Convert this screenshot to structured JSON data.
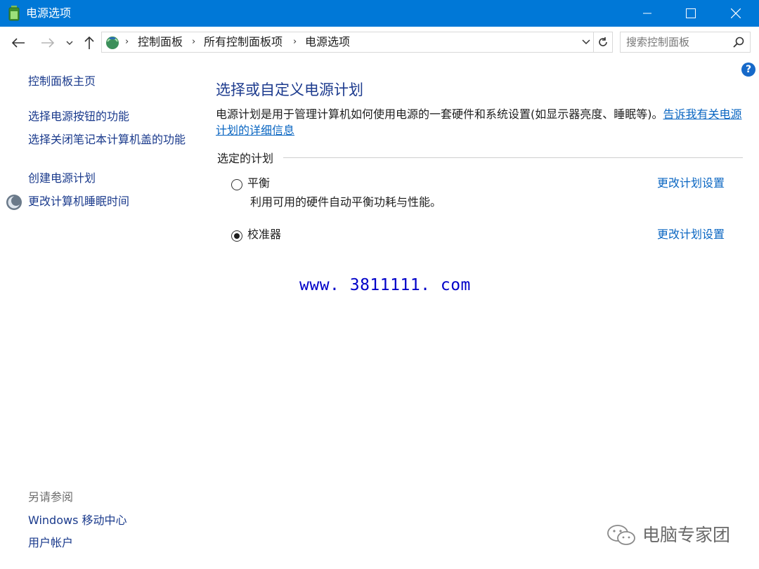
{
  "window": {
    "title": "电源选项"
  },
  "toolbar": {
    "breadcrumbs": [
      "控制面板",
      "所有控制面板项",
      "电源选项"
    ],
    "search_placeholder": "搜索控制面板"
  },
  "sidebar": {
    "home": "控制面板主页",
    "links": [
      "选择电源按钮的功能",
      "选择关闭笔记本计算机盖的功能",
      "创建电源计划",
      "更改计算机睡眠时间"
    ],
    "see_also_label": "另请参阅",
    "see_also": [
      "Windows 移动中心",
      "用户帐户"
    ]
  },
  "main": {
    "heading": "选择或自定义电源计划",
    "description": "电源计划是用于管理计算机如何使用电源的一套硬件和系统设置(如显示器亮度、睡眠等)。",
    "description_link": "告诉我有关电源计划的详细信息",
    "section_label": "选定的计划",
    "plans": [
      {
        "name": "平衡",
        "description": "利用可用的硬件自动平衡功耗与性能。",
        "selected": false,
        "action": "更改计划设置"
      },
      {
        "name": "校准器",
        "description": "",
        "selected": true,
        "action": "更改计划设置"
      }
    ]
  },
  "overlay": {
    "url_watermark": "www. 3811111. com",
    "brand_text": "电脑专家团"
  },
  "colors": {
    "titlebar": "#0078d7",
    "link": "#0a66c2",
    "heading": "#1d3b8e",
    "watermark": "#0000c8"
  }
}
